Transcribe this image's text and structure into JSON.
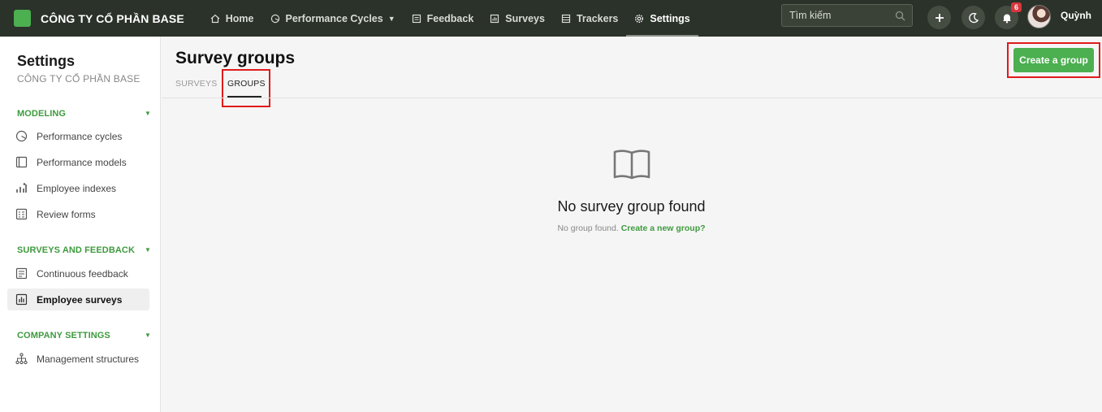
{
  "brand": {
    "name": "CÔNG TY CỔ PHẦN BASE",
    "logo_color": "#4caf50"
  },
  "nav": [
    {
      "label": "Home",
      "icon": "home-icon"
    },
    {
      "label": "Performance Cycles",
      "icon": "cycle-icon",
      "has_dropdown": true
    },
    {
      "label": "Feedback",
      "icon": "feedback-icon"
    },
    {
      "label": "Surveys",
      "icon": "surveys-icon"
    },
    {
      "label": "Trackers",
      "icon": "trackers-icon"
    },
    {
      "label": "Settings",
      "icon": "gear-icon",
      "active": true
    }
  ],
  "search": {
    "placeholder": "Tìm kiếm"
  },
  "notifications": {
    "count": "6"
  },
  "user": {
    "name": "Quỳnh"
  },
  "sidebar": {
    "title": "Settings",
    "subtitle": "CÔNG TY CỔ PHẦN BASE",
    "sections": [
      {
        "label": "MODELING",
        "items": [
          "Performance cycles",
          "Performance models",
          "Employee indexes",
          "Review forms"
        ]
      },
      {
        "label": "SURVEYS AND FEEDBACK",
        "items": [
          "Continuous feedback",
          "Employee surveys"
        ]
      },
      {
        "label": "COMPANY SETTINGS",
        "items": [
          "Management structures"
        ]
      }
    ],
    "active_item": "Employee surveys"
  },
  "main": {
    "title": "Survey groups",
    "tabs": [
      {
        "label": "SURVEYS"
      },
      {
        "label": "GROUPS",
        "active": true
      }
    ],
    "create_button": "Create a group",
    "empty": {
      "title": "No survey group found",
      "text": "No group found.",
      "link": "Create a new group?"
    }
  },
  "colors": {
    "topbar": "#2b3229",
    "accent": "#4caf50",
    "highlight": "#e01b1b",
    "badge": "#d9363e"
  }
}
